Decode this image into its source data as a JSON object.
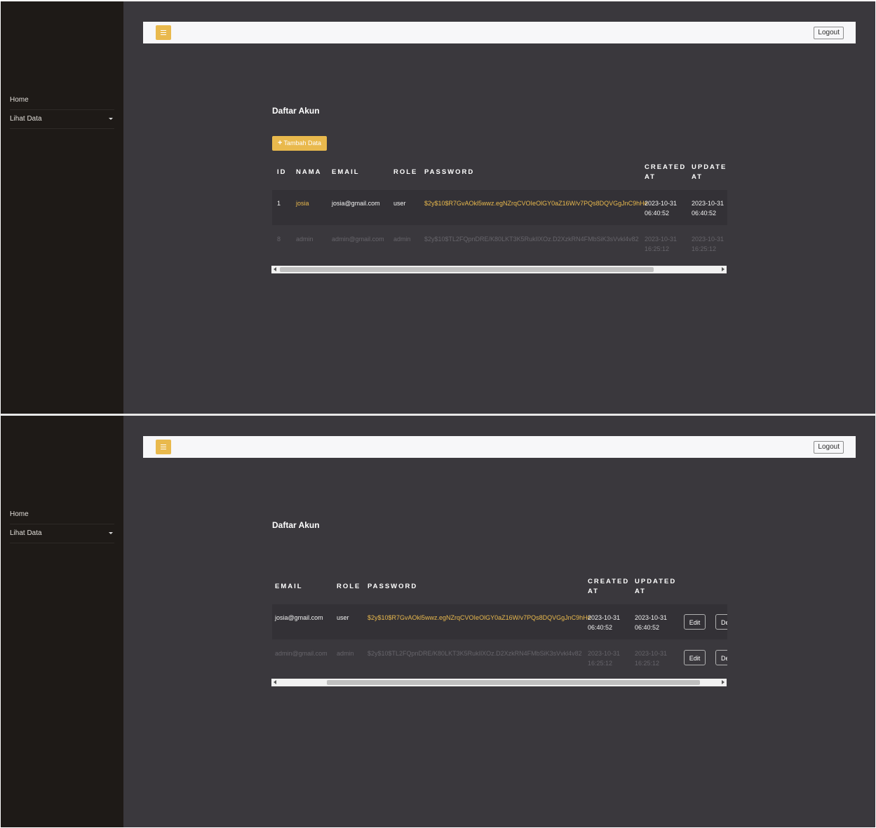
{
  "sidebar": {
    "items": [
      {
        "label": "Home"
      },
      {
        "label": "Lihat Data"
      }
    ]
  },
  "topbar": {
    "menu_icon": "hamburger-icon",
    "logout_label": "Logout"
  },
  "page": {
    "title": "Daftar Akun",
    "add_button_label": "Tambah Data",
    "add_icon": "plus-icon"
  },
  "table": {
    "headers": {
      "id": "ID",
      "nama": "NAMA",
      "email": "EMAIL",
      "role": "ROLE",
      "password": "PASSWORD",
      "created": [
        "CREATED",
        "AT"
      ],
      "updated": [
        "UPDATED",
        "AT"
      ]
    },
    "rows": [
      {
        "id": "1",
        "nama": "josia",
        "email": "josia@gmail.com",
        "role": "user",
        "password": "$2y$10$R7GvAOkl5wwz.egNZrqCVOIeOlGY0aZ16W/v7PQs8DQVGgJnC9hHe",
        "created_date": "2023-10-31",
        "created_time": "06:40:52",
        "updated_date": "2023-10-31",
        "updated_time": "06:40:52"
      },
      {
        "id": "8",
        "nama": "admin",
        "email": "admin@gmail.com",
        "role": "admin",
        "password": "$2y$10$TL2FQpnDRE/K80LKT3K5RukIlXOz.D2XzkRN4FMbSiK3sVvkl4v82",
        "created_date": "2023-10-31",
        "created_time": "16:25:12",
        "updated_date": "2023-10-31",
        "updated_time": "16:25:12"
      }
    ],
    "actions": {
      "edit": "Edit",
      "delete_visible": "De"
    }
  },
  "colors": {
    "accent": "#e9b94d",
    "sidebar_bg": "#1e1a17",
    "content_bg": "#3a383d",
    "topbar_bg": "#f7f7f9"
  }
}
